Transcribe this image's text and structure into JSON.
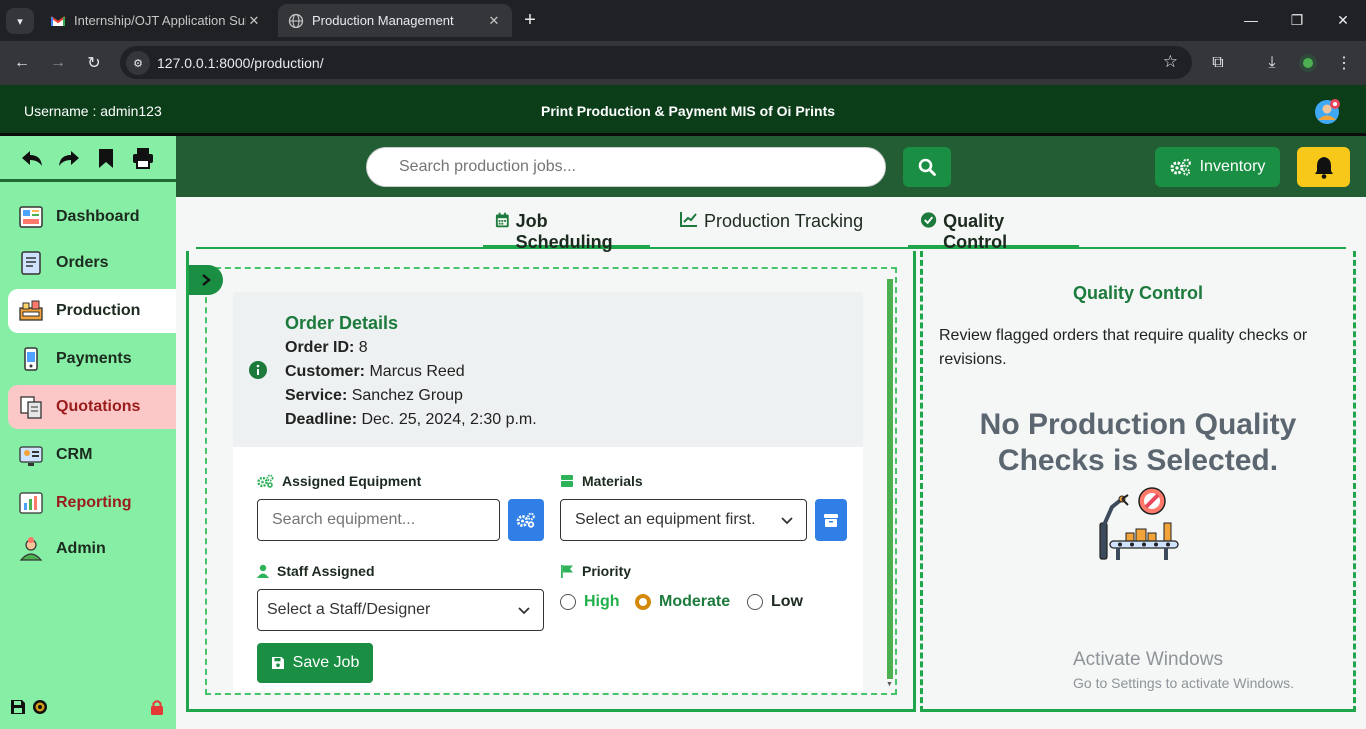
{
  "browser": {
    "tabs": [
      {
        "title": "Internship/OJT Application Sub",
        "favicon": "gmail-icon",
        "active": false
      },
      {
        "title": "Production Management",
        "favicon": "globe-icon",
        "active": true
      }
    ],
    "url": "127.0.0.1:8000/production/"
  },
  "header": {
    "username": "Username : admin123",
    "title": "Print Production & Payment MIS of Oi Prints"
  },
  "sidebar": {
    "items": [
      {
        "label": "Dashboard",
        "icon": "dashboard-icon"
      },
      {
        "label": "Orders",
        "icon": "orders-icon"
      },
      {
        "label": "Production",
        "icon": "production-icon"
      },
      {
        "label": "Payments",
        "icon": "payments-icon"
      },
      {
        "label": "Quotations",
        "icon": "quotations-icon"
      },
      {
        "label": "CRM",
        "icon": "crm-icon"
      },
      {
        "label": "Reporting",
        "icon": "reporting-icon"
      },
      {
        "label": "Admin",
        "icon": "admin-icon"
      }
    ]
  },
  "topbar": {
    "search_placeholder": "Search production jobs...",
    "inventory_label": "Inventory"
  },
  "tabs": {
    "job_scheduling": "Job Scheduling",
    "production_tracking": "Production Tracking",
    "quality_control": "Quality Control"
  },
  "order": {
    "heading": "Order Details",
    "order_id_label": "Order ID:",
    "order_id": "8",
    "customer_label": "Customer:",
    "customer": "Marcus Reed",
    "service_label": "Service:",
    "service": "Sanchez Group",
    "deadline_label": "Deadline:",
    "deadline": "Dec. 25, 2024, 2:30 p.m."
  },
  "form": {
    "equipment_label": "Assigned Equipment",
    "equipment_placeholder": "Search equipment...",
    "materials_label": "Materials",
    "materials_value": "Select an equipment first.",
    "staff_label": "Staff Assigned",
    "staff_value": "Select a Staff/Designer",
    "priority_label": "Priority",
    "priority_options": [
      "High",
      "Moderate",
      "Low"
    ],
    "priority_selected": "Moderate",
    "save_label": "Save Job"
  },
  "quality": {
    "title": "Quality Control",
    "description": "Review flagged orders that require quality checks or revisions.",
    "empty_line1": "No Production Quality",
    "empty_line2": "Checks is Selected."
  },
  "watermark": {
    "line1": "Activate Windows",
    "line2": "Go to Settings to activate Windows."
  },
  "colors": {
    "header_bg": "#0b3d19",
    "sidebar_bg": "#86efa5",
    "accent_green": "#1a8f43",
    "bell_yellow": "#f7c71a",
    "blue_button": "#2f7fe6",
    "priority_high": "#22b04b",
    "priority_moderate": "#1c7a3c"
  }
}
